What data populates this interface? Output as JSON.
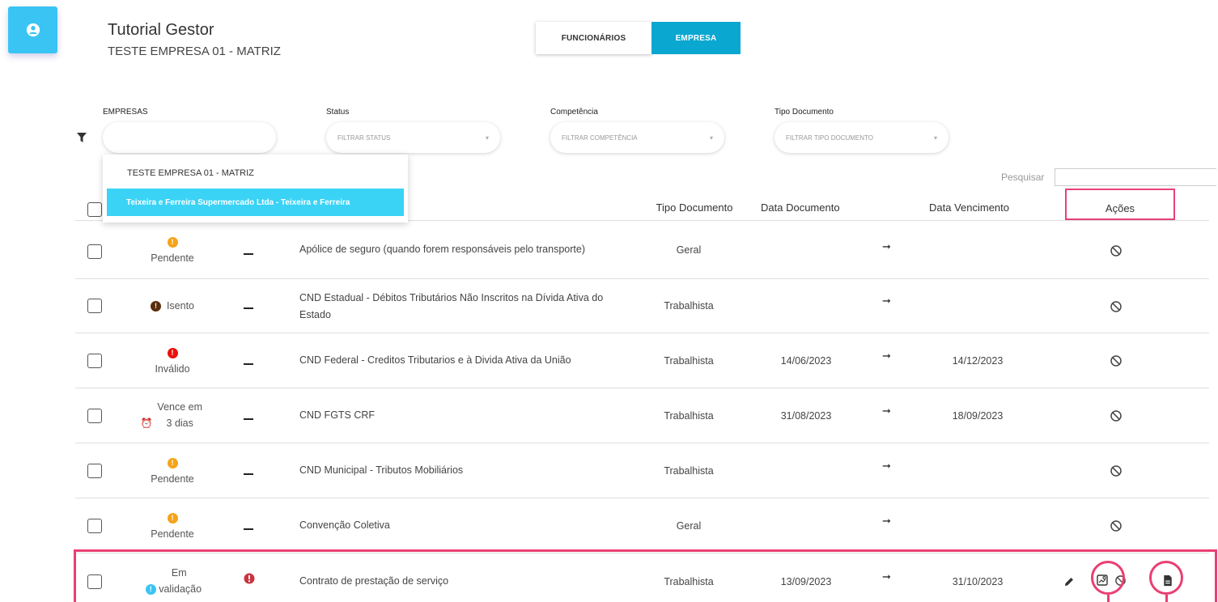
{
  "header": {
    "title": "Tutorial Gestor",
    "subtitle": "TESTE EMPRESA 01 - MATRIZ"
  },
  "tabs": {
    "funcionarios": "FUNCIONÁRIOS",
    "empresa": "EMPRESA"
  },
  "filters": {
    "empresas": {
      "label": "EMPRESAS",
      "value": ""
    },
    "status": {
      "label": "Status",
      "placeholder": "FILTRAR STATUS"
    },
    "competencia": {
      "label": "Competência",
      "placeholder": "FILTRAR COMPETÊNCIA"
    },
    "tipo": {
      "label": "Tipo Documento",
      "placeholder": "FILTRAR TIPO DOCUMENTO"
    }
  },
  "dropdown": {
    "options": [
      "TESTE EMPRESA 01 - MATRIZ",
      "Teixeira e Ferreira Supermercado Ltda - Teixeira e Ferreira"
    ],
    "highlighted_index": 1
  },
  "search": {
    "label": "Pesquisar",
    "value": ""
  },
  "columns": {
    "tipo": "Tipo Documento",
    "data_doc": "Data Documento",
    "data_venc": "Data Vencimento",
    "acoes": "Ações"
  },
  "rows": [
    {
      "status": "Pendente",
      "status_icon": "alert-icon",
      "status_color": "#f5a31a",
      "desc": "Apólice de seguro (quando forem responsáveis pelo transporte)",
      "tipo": "Geral",
      "data_doc": "",
      "data_venc": ""
    },
    {
      "status": "Isento",
      "status_icon": "alert-icon",
      "status_color": "#5a2d0c",
      "desc": "CND Estadual - Débitos Tributários Não Inscritos na Dívida Ativa do Estado",
      "tipo": "Trabalhista",
      "data_doc": "",
      "data_venc": ""
    },
    {
      "status": "Inválido",
      "status_icon": "alert-icon",
      "status_color": "#e8120c",
      "desc": "CND Federal - Creditos Tributarios e à Divida Ativa da União",
      "tipo": "Trabalhista",
      "data_doc": "14/06/2023",
      "data_venc": "14/12/2023"
    },
    {
      "status": "Vence em 3 dias",
      "status_icon": "alarm-clock-icon",
      "status_color": "#f5a31a",
      "desc": "CND FGTS CRF",
      "tipo": "Trabalhista",
      "data_doc": "31/08/2023",
      "data_venc": "18/09/2023"
    },
    {
      "status": "Pendente",
      "status_icon": "alert-icon",
      "status_color": "#f5a31a",
      "desc": "CND Municipal - Tributos Mobiliários",
      "tipo": "Trabalhista",
      "data_doc": "",
      "data_venc": ""
    },
    {
      "status": "Pendente",
      "status_icon": "alert-icon",
      "status_color": "#f5a31a",
      "desc": "Convenção Coletiva",
      "tipo": "Geral",
      "data_doc": "",
      "data_venc": ""
    },
    {
      "status": "Em validação",
      "status_icon": "info-icon",
      "status_color": "#3ac4f4",
      "desc": "Contrato de prestação de serviço",
      "tipo": "Trabalhista",
      "data_doc": "13/09/2023",
      "data_venc": "31/10/2023"
    }
  ],
  "colors": {
    "accent": "#0aa7d1",
    "highlight": "#ea3f72",
    "dropdown_highlight": "#3ad3f6"
  }
}
